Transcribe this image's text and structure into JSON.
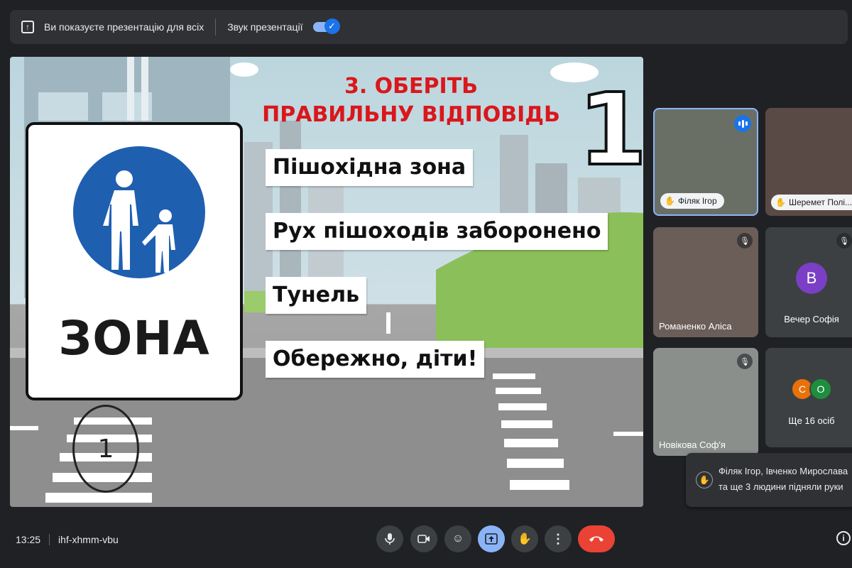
{
  "banner": {
    "presenting_text": "Ви показуєте презентацію для всіх",
    "sound_label": "Звук презентації",
    "sound_on": true
  },
  "slide": {
    "title_line1": "3. ОБЕРІТЬ",
    "title_line2": "ПРАВИЛЬНУ ВІДПОВІДЬ",
    "big_number": "1",
    "sign_text": "ЗОНА",
    "answers": [
      "Пішохідна зона",
      "Рух пішоходів заборонено",
      "Тунель",
      "Обережно, діти!"
    ],
    "handwritten_mark": "1"
  },
  "participants": [
    {
      "name": "Філяк Ігор",
      "hand_raised": true,
      "speaking": true
    },
    {
      "name": "Шеремет Полі...",
      "hand_raised": true
    },
    {
      "name": "Романенко Аліса",
      "muted": true
    },
    {
      "name": "Вечер Софія",
      "initial": "В",
      "muted": true
    },
    {
      "name": "Новікова Соф'я",
      "muted": true
    },
    {
      "name": "Ще 16 осіб",
      "initials": [
        "С",
        "О"
      ]
    }
  ],
  "toast": {
    "line1": "Філяк Ігор, Івченко Мирослава",
    "line2": "та ще 3 людини підняли руки"
  },
  "meeting": {
    "time": "13:25",
    "code": "ihf-xhmm-vbu"
  },
  "colors": {
    "accent": "#8ab4f8",
    "hangup": "#ea4335",
    "title_red": "#d9171c",
    "sign_blue": "#1f5fb0"
  }
}
